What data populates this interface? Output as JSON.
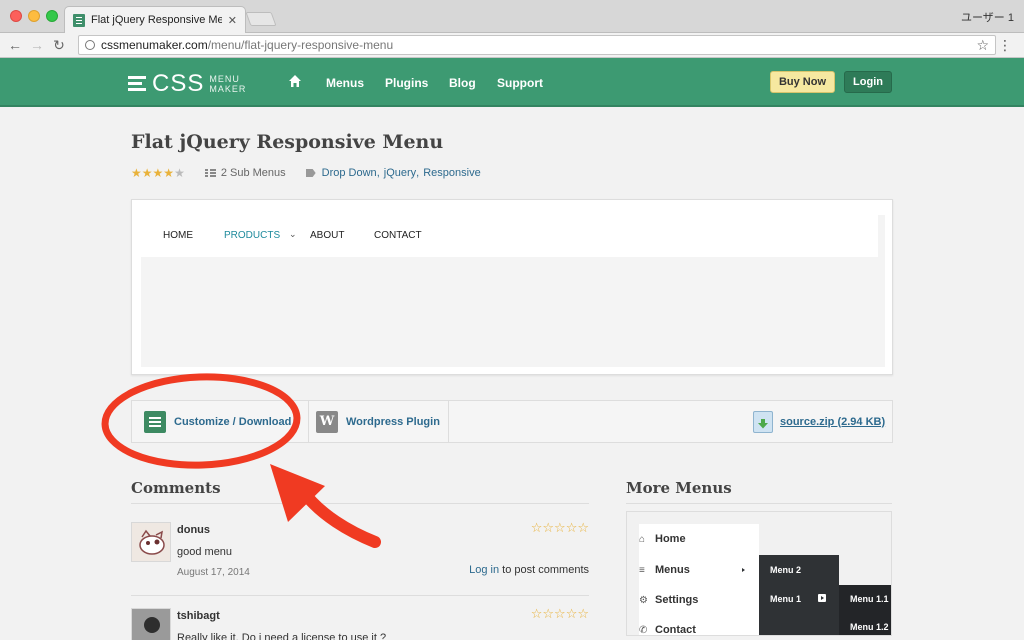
{
  "browser": {
    "tab_title": "Flat jQuery Responsive Menu |",
    "user_label": "ユーザー 1",
    "url_host": "cssmenumaker.com",
    "url_path": "/menu/flat-jquery-responsive-menu"
  },
  "site": {
    "logo_main": "CSS",
    "logo_line1": "MENU",
    "logo_line2": "MAKER",
    "nav": [
      "Menus",
      "Plugins",
      "Blog",
      "Support"
    ],
    "buy_label": "Buy Now",
    "login_label": "Login",
    "brand_color": "#3d9a72"
  },
  "page": {
    "title": "Flat jQuery Responsive Menu",
    "rating": 4,
    "sub_menus": "2 Sub Menus",
    "tags": [
      "Drop Down",
      "jQuery",
      "Responsive"
    ],
    "tag_sep": ","
  },
  "preview": {
    "items": [
      "HOME",
      "PRODUCTS",
      "ABOUT",
      "CONTACT"
    ],
    "active_item": "PRODUCTS",
    "caret": "⌄"
  },
  "toolbar": {
    "customize_label": "Customize / Download",
    "wordpress_label": "Wordpress Plugin",
    "zip_label": "source.zip (2.94 KB)"
  },
  "comments": {
    "heading": "Comments",
    "items": [
      {
        "author": "donus",
        "text": "good menu",
        "date": "August 17, 2014",
        "rating": 5,
        "login_link": "Log in",
        "login_suffix": " to post comments"
      },
      {
        "author": "tshibagt",
        "text": "Really like it. Do i need a license to use it ?",
        "rating": 5
      }
    ]
  },
  "more_menus": {
    "heading": "More Menus",
    "items": [
      "Home",
      "Menus",
      "Settings",
      "Contact"
    ],
    "sub_items": [
      "Menu 2",
      "Menu 1",
      "Menu 1.1",
      "Menu 1.2"
    ]
  },
  "annotation": {
    "circle_color": "#f03a22",
    "arrow_color": "#f03a22"
  }
}
